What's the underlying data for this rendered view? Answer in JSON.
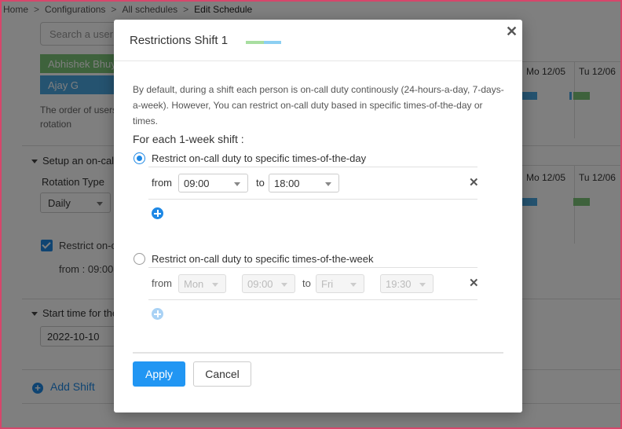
{
  "breadcrumb": {
    "items": [
      "Home",
      "Configurations",
      "All schedules",
      "Edit Schedule"
    ],
    "separator": ">"
  },
  "background": {
    "search_placeholder": "Search a user",
    "users": [
      "Abhishek Bhuyan",
      "Ajay G"
    ],
    "order_text": "The order of users rotation",
    "setup_heading": "Setup an on-call",
    "rotation_type_label": "Rotation Type",
    "rotation_type_value": "Daily",
    "restrict_label": "Restrict on-call",
    "restrict_from": "from : 09:00",
    "start_time_heading": "Start time for the",
    "start_date": "2022-10-10",
    "add_shift_label": "Add Shift",
    "calendar_days": [
      "Mo 12/05",
      "Tu 12/06"
    ]
  },
  "modal": {
    "title": "Restrictions Shift 1",
    "close_icon": "close-icon",
    "shift_colors": [
      "#a8dea0",
      "#8ccff2"
    ],
    "description": "By default, during a shift each person is on-call duty continously (24-hours-a-day, 7-days-a-week). However, You can restrict on-call duty based in specific times-of-the-day or times.",
    "for_each_label": "For each 1-week shift :",
    "option_day": {
      "label": "Restrict on-call duty to specific times-of-the-day",
      "selected": true,
      "from_label": "from",
      "from_value": "09:00",
      "to_label": "to",
      "to_value": "18:00"
    },
    "option_week": {
      "label": "Restrict on-call duty to specific times-of-the-week",
      "selected": false,
      "from_label": "from",
      "from_day": "Mon",
      "from_time": "09:00",
      "to_label": "to",
      "to_day": "Fri",
      "to_time": "19:30"
    },
    "apply_label": "Apply",
    "cancel_label": "Cancel"
  },
  "colors": {
    "accent": "#2196f3",
    "frame": "#d6466b"
  }
}
